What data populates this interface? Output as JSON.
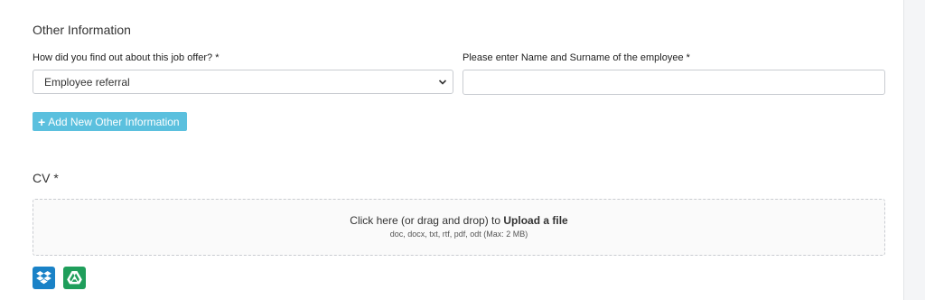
{
  "section": {
    "title": "Other Information"
  },
  "fields": {
    "source": {
      "label": "How did you find out about this job offer? *",
      "value": "Employee referral"
    },
    "employee_name": {
      "label": "Please enter Name and Surname of the employee *",
      "value": ""
    }
  },
  "add_button": {
    "icon": "plus-icon",
    "label": "Add New Other Information"
  },
  "cv": {
    "title": "CV *",
    "dropzone": {
      "text_prefix": "Click here (or drag and drop) to ",
      "text_strong": "Upload a file",
      "formats": "doc, docx, txt, rtf, pdf, odt (Max: 2 MB)"
    },
    "cloud_buttons": [
      {
        "icon": "dropbox-icon",
        "color": "#1a82c7"
      },
      {
        "icon": "google-drive-icon",
        "color": "#1f9e5b"
      }
    ]
  },
  "colors": {
    "info_button": "#5bc0de"
  }
}
